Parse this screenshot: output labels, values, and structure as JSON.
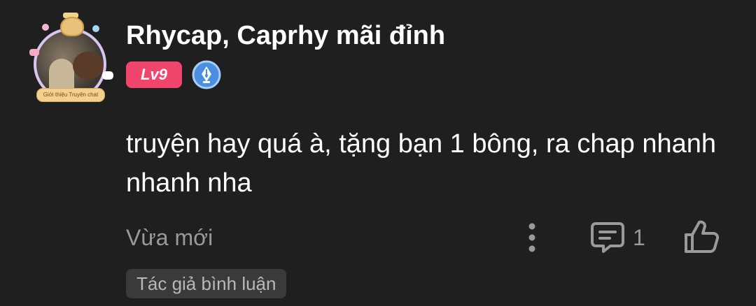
{
  "comment": {
    "avatar": {
      "frame_ribbon_text": "Giới thiệu Truyện chat",
      "frame_icon": "bear-crown-frame"
    },
    "username": "Rhycap, Caprhy mãi đỉnh",
    "level_badge": "Lv9",
    "author_badge_icon": "pen-nib-badge-icon",
    "content": "truyện hay quá à, tặng bạn 1 bông, ra chap nhanh nhanh nha",
    "timestamp": "Vừa mới",
    "actions": {
      "more_icon": "vertical-dots-icon",
      "reply_icon": "comment-icon",
      "reply_count": "1",
      "like_icon": "thumbs-up-icon"
    },
    "tag": "Tác giả bình luận"
  },
  "colors": {
    "background": "#1f1f1f",
    "level_badge": "#f2456b",
    "author_badge": "#4a8fe0",
    "muted_text": "#9a9a9a",
    "tag_bg": "#3a3a3a"
  }
}
